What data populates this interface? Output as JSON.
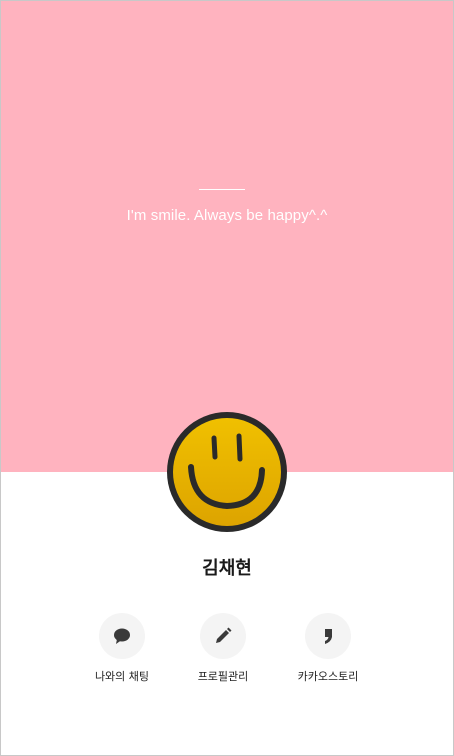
{
  "profile": {
    "status_message": "I'm smile. Always be happy^.^",
    "name": "김채현"
  },
  "actions": [
    {
      "label": "나와의 채팅",
      "icon": "chat-bubble-icon"
    },
    {
      "label": "프로필관리",
      "icon": "pencil-icon"
    },
    {
      "label": "카카오스토리",
      "icon": "comma-quote-icon"
    }
  ],
  "colors": {
    "cover_background": "#ffb3bf",
    "avatar_face": "#e8b400",
    "icon_dark": "#3a3a3a"
  }
}
